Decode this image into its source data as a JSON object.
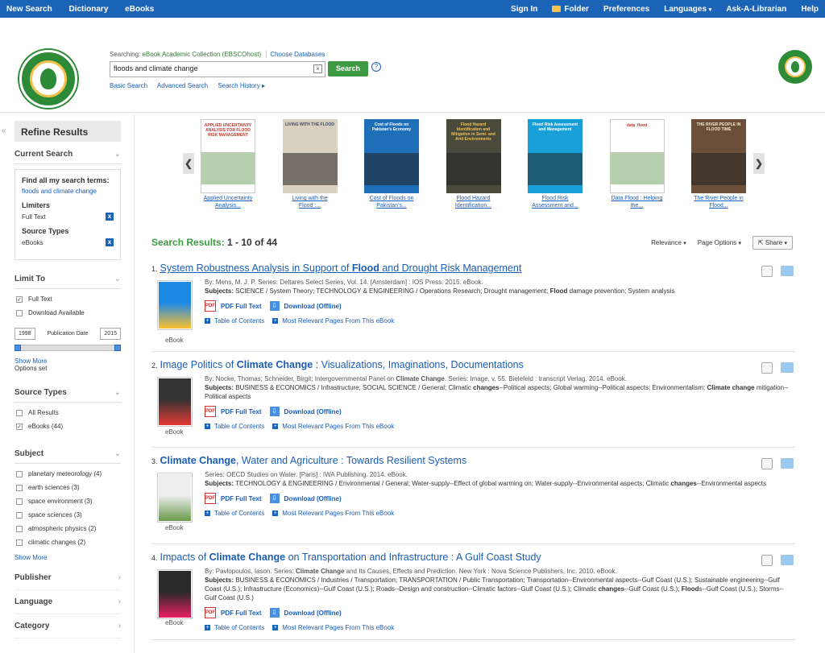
{
  "topbar": {
    "left": [
      "New Search",
      "Dictionary",
      "eBooks"
    ],
    "right": [
      "Sign In",
      "Folder",
      "Preferences",
      "Languages",
      "Ask-A-Librarian",
      "Help"
    ]
  },
  "header": {
    "searching_label": "Searching:",
    "database": "eBook Academic Collection (EBSCOhost)",
    "choose_db": "Choose Databases",
    "query": "floods and climate change",
    "search_btn": "Search",
    "help": "?",
    "basic": "Basic Search",
    "advanced": "Advanced Search",
    "history": "Search History"
  },
  "sidebar": {
    "refine": "Refine Results",
    "current_search": "Current Search",
    "find_all": "Find all my search terms:",
    "find_value": "floods and climate change",
    "limiters": "Limiters",
    "limiter_value": "Full Text",
    "source_types_h": "Source Types",
    "source_value": "eBooks",
    "limit_to": "Limit To",
    "limit_items": [
      "Full Text",
      "Download Available"
    ],
    "pub_from": "1998",
    "pub_label": "Publication Date",
    "pub_to": "2015",
    "show_more": "Show More",
    "options_set": "Options set",
    "source_types": "Source Types",
    "source_items": [
      "All Results",
      "eBooks (44)"
    ],
    "subject": "Subject",
    "subject_items": [
      "planetary meteorology (4)",
      "earth sciences (3)",
      "space environment (3)",
      "space sciences (3)",
      "atmospheric physics (2)",
      "climatic changes (2)"
    ],
    "show_more2": "Show More",
    "publisher": "Publisher",
    "language": "Language",
    "category": "Category"
  },
  "carousel": [
    {
      "caption1": "Applied Uncertainty",
      "caption2": "Analysis...",
      "cover_title": "APPLIED UNCERTAINTY ANALYSIS FOR FLOOD RISK MANAGEMENT",
      "bg": "#ffffff",
      "fg": "#c0392b"
    },
    {
      "caption1": "Living with the",
      "caption2": "Flood :...",
      "cover_title": "LIVING WITH THE FLOOD",
      "bg": "#d9d0bf",
      "fg": "#3b4c6b"
    },
    {
      "caption1": "Cost of Floods on",
      "caption2": "Pakistan's...",
      "cover_title": "Cost of Floods on Pakistan's Economy",
      "bg": "#1e6fb8",
      "fg": "#ffffff"
    },
    {
      "caption1": "Flood Hazard",
      "caption2": "Identification...",
      "cover_title": "Flood Hazard Identification and Mitigation in Semi- and Arid Environments",
      "bg": "#4a4a3c",
      "fg": "#f2c14e"
    },
    {
      "caption1": "Flood Risk",
      "caption2": "Assessment and...",
      "cover_title": "Flood Risk Assessment and Management",
      "bg": "#1aa0d8",
      "fg": "#ffffff"
    },
    {
      "caption1": "Data Flood : Helping",
      "caption2": "the...",
      "cover_title": "data_flood",
      "bg": "#ffffff",
      "fg": "#c0392b"
    },
    {
      "caption1": "The River People in",
      "caption2": "Flood...",
      "cover_title": "THE RIVER PEOPLE IN FLOOD TIME",
      "bg": "#6b4f3a",
      "fg": "#f5e6c8"
    }
  ],
  "results_head": {
    "label": "Search Results:",
    "range": "1 - 10 of 44"
  },
  "results_opts": [
    "Relevance",
    "Page Options",
    "Share"
  ],
  "results": [
    {
      "n": "1.",
      "title_parts": [
        {
          "t": "System Robustness Analysis in Support of ",
          "b": false
        },
        {
          "t": "Flood",
          "b": true
        },
        {
          "t": " and Drought Risk Management",
          "b": false
        }
      ],
      "meta": "By: Mens, M. J. P. Series: Deltares Select Series, Vol. 14. [Amsterdam] : IOS Press. 2015. eBook.",
      "subjects_label": "Subjects:",
      "subjects": "SCIENCE / System Theory; TECHNOLOGY & ENGINEERING / Operations Research; Drought management; Flood damage prevention; System analysis",
      "pdf": "PDF Full Text",
      "download": "Download (Offline)",
      "toc": "Table of Contents",
      "rel": "Most Relevant Pages From This eBook",
      "label": "eBook"
    },
    {
      "n": "2.",
      "title_parts": [
        {
          "t": "Image Politics of ",
          "b": false
        },
        {
          "t": "Climate Change",
          "b": true
        },
        {
          "t": " : Visualizations, Imaginations, Documentations",
          "b": false
        }
      ],
      "meta": "By: Nocke, Thomas; Schneider, Birgit; Intergovernmental Panel on Climate Change. Series: Image, v. 55. Bielefeld : transcript Verlag. 2014. eBook.",
      "subjects_label": "Subjects:",
      "subjects": "BUSINESS & ECONOMICS / Infrastructure; SOCIAL SCIENCE / General; Climatic changes--Political aspects; Global warming--Political aspects; Environmentalism; Climate change mitigation--Political aspects",
      "pdf": "PDF Full Text",
      "download": "Download (Offline)",
      "toc": "Table of Contents",
      "rel": "Most Relevant Pages From This eBook",
      "label": "eBook"
    },
    {
      "n": "3.",
      "title_parts": [
        {
          "t": "Climate Change",
          "b": true
        },
        {
          "t": ", Water and Agriculture : Towards Resilient Systems",
          "b": false
        }
      ],
      "meta": "Series: OECD Studies on Water. [Paris] : IWA Publishing. 2014. eBook.",
      "subjects_label": "Subjects:",
      "subjects": "TECHNOLOGY & ENGINEERING / Environmental / General; Water-supply--Effect of global warming on; Water-supply--Environmental aspects; Climatic changes--Environmental aspects",
      "pdf": "PDF Full Text",
      "download": "Download (Offline)",
      "toc": "Table of Contents",
      "rel": "Most Relevant Pages From This eBook",
      "label": "eBook"
    },
    {
      "n": "4.",
      "title_parts": [
        {
          "t": "Impacts of ",
          "b": false
        },
        {
          "t": "Climate Change",
          "b": true
        },
        {
          "t": " on Transportation and Infrastructure : A Gulf Coast Study",
          "b": false
        }
      ],
      "meta": "By: Pavlopoulos, Iason. Series: Climate Change and Its Causes, Effects and Prediction. New York : Nova Science Publishers, Inc. 2010. eBook.",
      "subjects_label": "Subjects:",
      "subjects": "BUSINESS & ECONOMICS / Industries / Transportation; TRANSPORTATION / Public Transportation; Transportation--Environmental aspects--Gulf Coast (U.S.); Sustainable engineering--Gulf Coast (U.S.); Infrastructure (Economics)--Gulf Coast (U.S.); Roads--Design and construction--Climatic factors--Gulf Coast (U.S.); Climatic changes--Gulf Coast (U.S.); Floods--Gulf Coast (U.S.); Storms--Gulf Coast (U.S.)",
      "pdf": "PDF Full Text",
      "download": "Download (Offline)",
      "toc": "Table of Contents",
      "rel": "Most Relevant Pages From This eBook",
      "label": "eBook"
    }
  ],
  "colors": {
    "topbar": "#1b63b7",
    "search_btn": "#3c9a43",
    "link": "#1a5db6"
  }
}
